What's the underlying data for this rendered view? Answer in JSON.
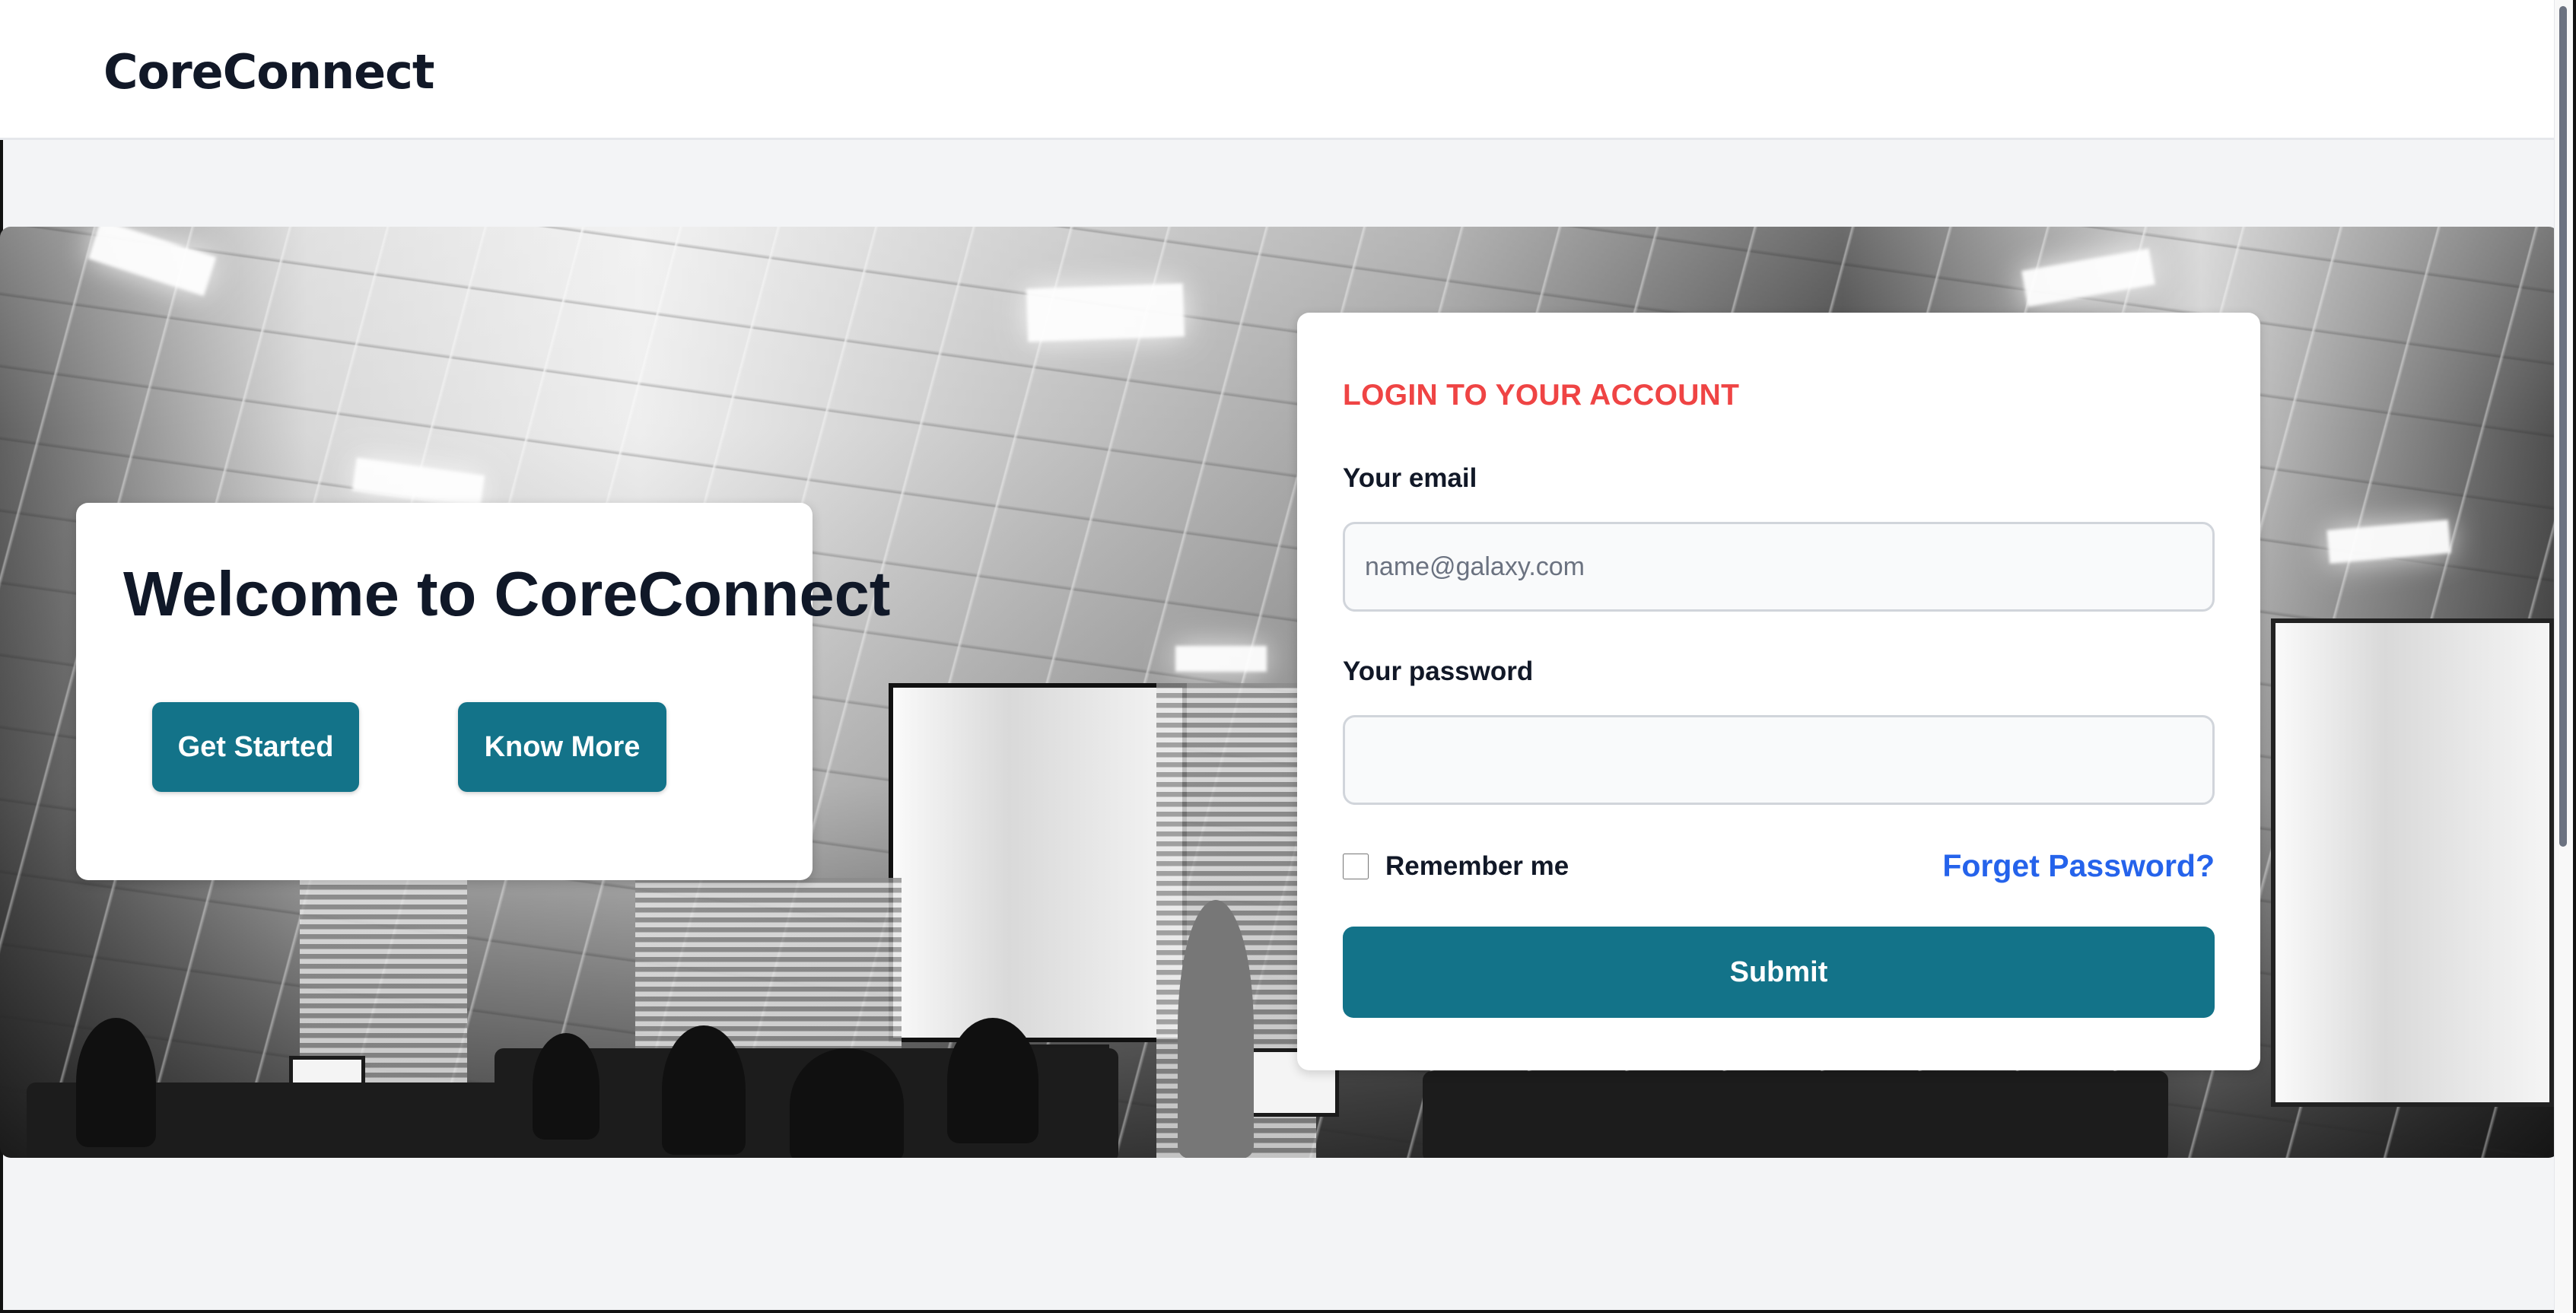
{
  "app": {
    "title": "CoreConnect"
  },
  "header": {
    "brand": "CoreConnect"
  },
  "hero": {
    "welcome_title": "Welcome to CoreConnect",
    "buttons": {
      "get_started": "Get Started",
      "know_more": "Know More"
    }
  },
  "login": {
    "heading": "LOGIN TO YOUR ACCOUNT",
    "email_label": "Your email",
    "email_placeholder": "name@galaxy.com",
    "email_value": "",
    "password_label": "Your password",
    "password_value": "",
    "remember_label": "Remember me",
    "forgot_password": "Forget Password?",
    "submit": "Submit"
  },
  "colors": {
    "primary": "#137389",
    "login_heading": "#ef4444",
    "link": "#2563eb",
    "background": "#f3f4f6",
    "surface": "#ffffff"
  }
}
